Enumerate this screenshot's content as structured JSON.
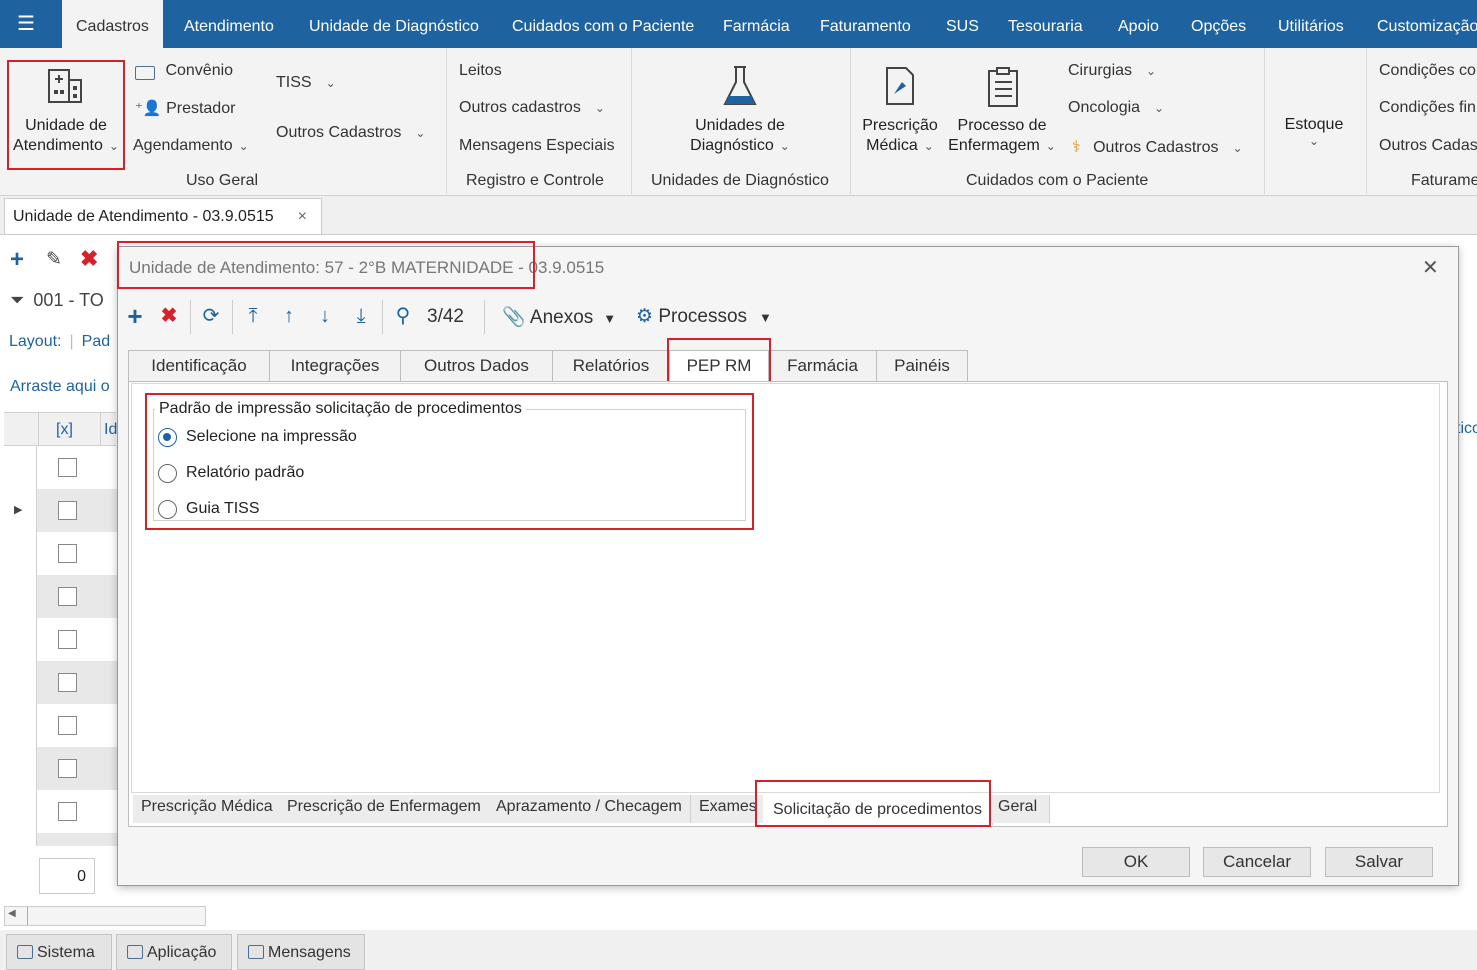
{
  "menubar": {
    "items": [
      "Cadastros",
      "Atendimento",
      "Unidade de Diagnóstico",
      "Cuidados com o Paciente",
      "Farmácia",
      "Faturamento",
      "SUS",
      "Tesouraria",
      "Apoio",
      "Opções",
      "Utilitários",
      "Customização"
    ]
  },
  "ribbon": {
    "unidade_line1": "Unidade de",
    "unidade_line2": "Atendimento",
    "convenio": "Convênio",
    "prestador": "Prestador",
    "agendamento": "Agendamento",
    "tiss": "TISS",
    "outros_cadastros_1": "Outros Cadastros",
    "uso_geral": "Uso Geral",
    "leitos": "Leitos",
    "outros_cadastros_lower": "Outros cadastros",
    "mensagens_especiais": "Mensagens Especiais",
    "registro_controle": "Registro e Controle",
    "unidades_diag_line1": "Unidades de",
    "unidades_diag_line2": "Diagnóstico",
    "unidades_diag_group": "Unidades de Diagnóstico",
    "prescricao_line1": "Prescrição",
    "prescricao_line2": "Médica",
    "processo_line1": "Processo de",
    "processo_line2": "Enfermagem",
    "cirurgias": "Cirurgias",
    "oncologia": "Oncologia",
    "outros_cadastros_2": "Outros Cadastros",
    "cuidados_group": "Cuidados com o Paciente",
    "estoque": "Estoque",
    "condicoes_1": "Condições co",
    "condicoes_2": "Condições fin",
    "outros_cadas": "Outros Cadas",
    "faturamento_group": "Faturame"
  },
  "doc_tab": {
    "title": "Unidade de Atendimento - 03.9.0515",
    "close": "×"
  },
  "background": {
    "filter_text": "001 - TO",
    "layout_label": "Layout:",
    "layout_value": "Pad",
    "drag_text": "Arraste aqui o",
    "col_x": "[x]",
    "col_id": "Id",
    "col_right": "tico",
    "footer_count": "0"
  },
  "dialog": {
    "title": "Unidade de Atendimento: 57 - 2°B MATERNIDADE - 03.9.0515",
    "close": "✕",
    "record_counter": "3/42",
    "anexos": "Anexos",
    "processos": "Processos",
    "tabs": [
      "Identificação",
      "Integrações",
      "Outros Dados",
      "Relatórios",
      "PEP RM",
      "Farmácia",
      "Painéis"
    ],
    "active_tab": "PEP RM",
    "group_title": "Padrão de impressão solicitação de procedimentos",
    "options": [
      "Selecione na impressão",
      "Relatório padrão",
      "Guia TISS"
    ],
    "selected_option": "Selecione na impressão",
    "bottom_tabs": [
      "Prescrição Médica",
      "Prescrição de Enfermagem",
      "Aprazamento / Checagem",
      "Exames",
      "Solicitação de procedimentos",
      "Geral"
    ],
    "active_bottom_tab": "Solicitação de procedimentos",
    "buttons": {
      "ok": "OK",
      "cancel": "Cancelar",
      "save": "Salvar"
    }
  },
  "statusbar": {
    "items": [
      "Sistema",
      "Aplicação",
      "Mensagens"
    ]
  },
  "colors": {
    "brand": "#1e63a0",
    "highlight": "#d6202a",
    "add_icon": "#1e63a0",
    "delete_icon": "#d6202a"
  }
}
